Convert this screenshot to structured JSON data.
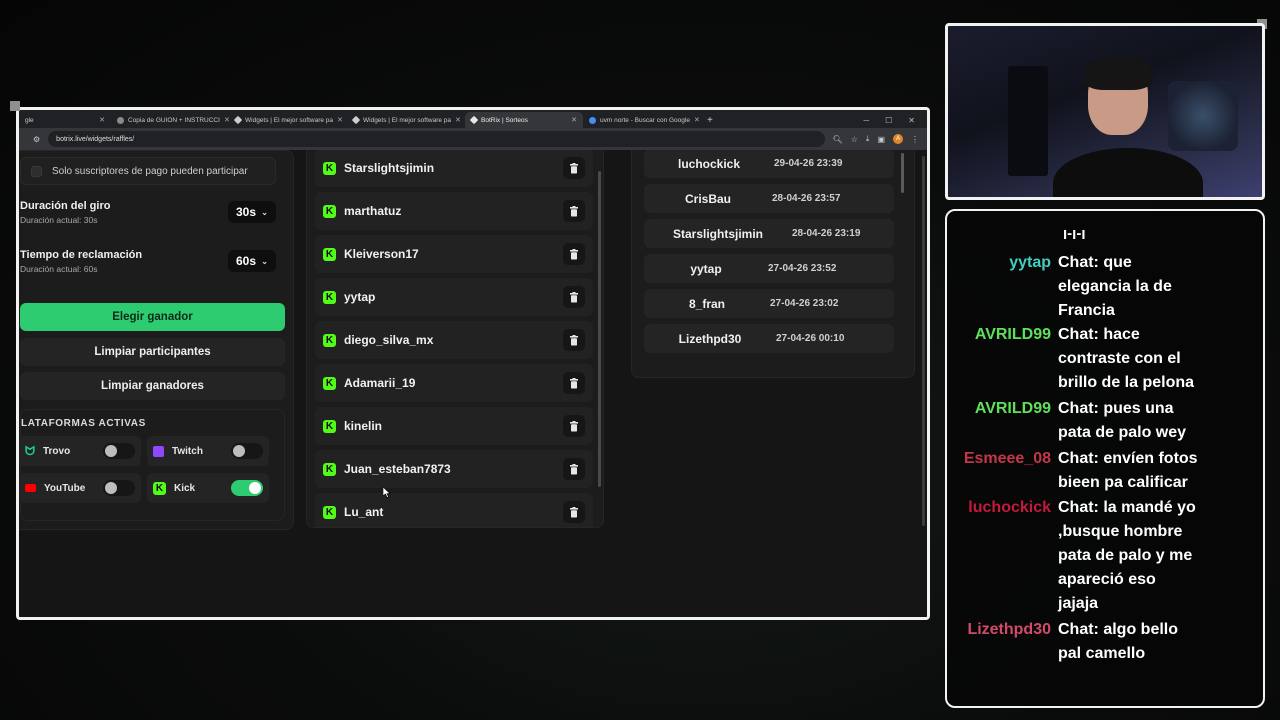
{
  "browser": {
    "tabs": [
      {
        "label": "gle",
        "active": false
      },
      {
        "label": "Copia de GUION + INSTRUCCI",
        "active": false
      },
      {
        "label": "Widgets | El mejor software pa",
        "active": false
      },
      {
        "label": "Widgets | El mejor software pa",
        "active": false
      },
      {
        "label": "BotRix | Sorteos",
        "active": true
      },
      {
        "label": "uvm norte - Buscar con Google",
        "active": false
      }
    ],
    "new_tab": "+",
    "url": "botrix.live/widgets/raffles/",
    "profile_initial": "A"
  },
  "settings": {
    "paid_subs_label": "Solo suscriptores de pago pueden participar",
    "spin": {
      "title": "Duración del giro",
      "subtitle": "Duración actual: 30s",
      "value": "30s"
    },
    "claim": {
      "title": "Tiempo de reclamación",
      "subtitle": "Duración actual: 60s",
      "value": "60s"
    },
    "pick_winner": "Elegir ganador",
    "clear_participants": "Limpiar participantes",
    "clear_winners": "Limpiar ganadores",
    "platforms_title": "LATAFORMAS ACTIVAS",
    "platforms": [
      {
        "name": "Trovo",
        "enabled": false
      },
      {
        "name": "Twitch",
        "enabled": false
      },
      {
        "name": "YouTube",
        "enabled": false
      },
      {
        "name": "Kick",
        "enabled": true
      }
    ]
  },
  "participants": [
    "Starslightsjimin",
    "marthatuz",
    "Kleiverson17",
    "yytap",
    "diego_silva_mx",
    "Adamarii_19",
    "kinelin",
    "Juan_esteban7873",
    "Lu_ant"
  ],
  "winners": [
    {
      "name": "luchockick",
      "date": "29-04-26 23:39"
    },
    {
      "name": "CrisBau",
      "date": "28-04-26 23:57"
    },
    {
      "name": "Starslightsjimin",
      "date": "28-04-26 23:19"
    },
    {
      "name": "yytap",
      "date": "27-04-26 23:52"
    },
    {
      "name": "8_fran",
      "date": "27-04-26 23:02"
    },
    {
      "name": "Lizethpd30",
      "date": "27-04-26 00:10"
    }
  ],
  "chat": {
    "partial_top": "j-j-j",
    "messages": [
      {
        "user": "yytap",
        "color": "#3fd0c0",
        "lines": [
          "Chat: que",
          "elegancia la de",
          "Francia"
        ]
      },
      {
        "user": "AVRILD99",
        "color": "#5ee05a",
        "lines": [
          "Chat: hace",
          "contraste con el",
          "brillo de la pelona"
        ]
      },
      {
        "user": "AVRILD99",
        "color": "#5ee05a",
        "lines": [
          "Chat: pues una",
          "pata de palo wey"
        ]
      },
      {
        "user": "Esmeee_08",
        "color": "#c2374a",
        "lines": [
          "Chat: envíen fotos",
          "bieen pa calificar"
        ]
      },
      {
        "user": "luchockick",
        "color": "#c21a3c",
        "lines": [
          "Chat: la mandé yo",
          ",busque hombre",
          "pata de palo y me",
          "apareció eso",
          "jajaja"
        ]
      },
      {
        "user": "Lizethpd30",
        "color": "#d24a6a",
        "lines": [
          "Chat: algo bello",
          "pal camello"
        ]
      }
    ]
  },
  "colors": {
    "accent": "#2ecc71",
    "kick": "#53fc18",
    "panel": "#1c1c1c"
  }
}
